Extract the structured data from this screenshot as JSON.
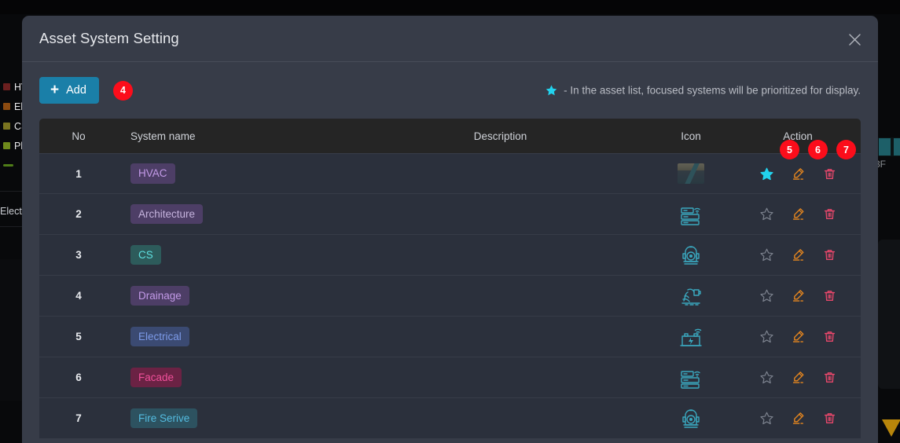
{
  "background": {
    "legend": [
      {
        "label": "HVAC",
        "color": "#6b1f1f",
        "type": "swatch"
      },
      {
        "label": "Electrical",
        "color": "#8a4a10",
        "type": "swatch"
      },
      {
        "label": "CS",
        "color": "#7a7420",
        "type": "swatch"
      },
      {
        "label": "Plumbing",
        "color": "#6f8a1c",
        "type": "swatch"
      },
      {
        "label": "",
        "color": "#4f7d18",
        "type": "dash"
      }
    ],
    "side_label": "Electrical",
    "floor_label": "3F"
  },
  "modal": {
    "title": "Asset System Setting",
    "close_icon": "close-icon"
  },
  "toolbar": {
    "add_label": "Add",
    "add_plus_icon": "plus-icon",
    "add_annotation": "4",
    "notice_star_icon": "star-filled-icon",
    "notice_text": "- In the asset list, focused systems will be prioritized for display."
  },
  "table": {
    "columns": {
      "no": "No",
      "system_name": "System name",
      "description": "Description",
      "icon": "Icon",
      "action": "Action"
    },
    "action_annotations": [
      "5",
      "6",
      "7"
    ],
    "action_icons": {
      "favorite": "star-icon",
      "edit": "pencil-edit-icon",
      "delete": "trash-icon"
    },
    "rows": [
      {
        "no": "1",
        "name": "HVAC",
        "name_bg": "#4d3e66",
        "name_fg": "#c39ae8",
        "description": "",
        "icon": "duct-thumbnail-icon",
        "favorited": true
      },
      {
        "no": "2",
        "name": "Architecture",
        "name_bg": "#4d3e66",
        "name_fg": "#c5b3dd",
        "description": "",
        "icon": "server-rack-wifi-icon",
        "favorited": false
      },
      {
        "no": "3",
        "name": "CS",
        "name_bg": "#2d5b5b",
        "name_fg": "#5ee0e0",
        "description": "",
        "icon": "fire-hydrant-icon",
        "favorited": false
      },
      {
        "no": "4",
        "name": "Drainage",
        "name_bg": "#4d3e66",
        "name_fg": "#c39ae8",
        "description": "",
        "icon": "drain-pump-icon",
        "favorited": false
      },
      {
        "no": "5",
        "name": "Electrical",
        "name_bg": "#3b4a72",
        "name_fg": "#7c9ae8",
        "description": "",
        "icon": "battery-wifi-icon",
        "favorited": false
      },
      {
        "no": "6",
        "name": "Facade",
        "name_bg": "#6b2244",
        "name_fg": "#f0509a",
        "description": "",
        "icon": "server-rack-wifi-icon",
        "favorited": false
      },
      {
        "no": "7",
        "name": "Fire Serive",
        "name_bg": "#2d5260",
        "name_fg": "#54bce0",
        "description": "",
        "icon": "fire-hydrant-icon",
        "favorited": false
      }
    ]
  },
  "colors": {
    "accent_blue": "#1a7fa8",
    "annotation_red": "#fc0d1b",
    "star_active": "#22d3ee",
    "star_inactive": "#7c828e",
    "edit_orange": "#e8871e",
    "delete_red": "#e8476b",
    "modal_bg": "#373c48",
    "row_bg": "#2b303c",
    "header_bg": "#252525"
  }
}
